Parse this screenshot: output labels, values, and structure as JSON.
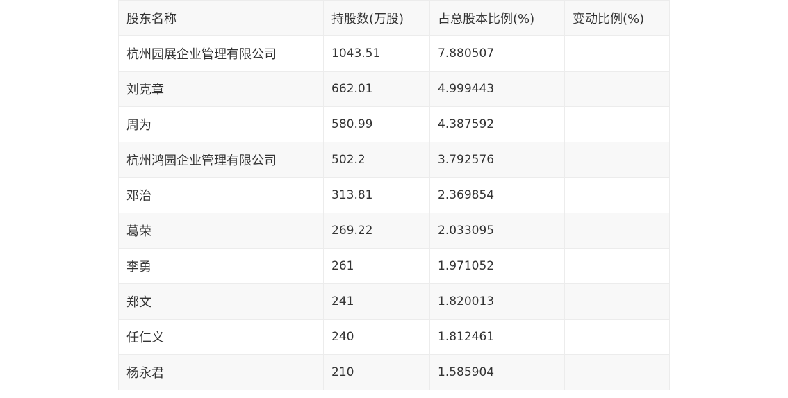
{
  "table": {
    "headers": [
      "股东名称",
      "持股数(万股)",
      "占总股本比例(%)",
      "变动比例(%)"
    ],
    "rows": [
      {
        "name": "杭州园展企业管理有限公司",
        "shares": "1043.51",
        "ratio": "7.880507",
        "change": ""
      },
      {
        "name": "刘克章",
        "shares": "662.01",
        "ratio": "4.999443",
        "change": ""
      },
      {
        "name": "周为",
        "shares": "580.99",
        "ratio": "4.387592",
        "change": ""
      },
      {
        "name": "杭州鸿园企业管理有限公司",
        "shares": "502.2",
        "ratio": "3.792576",
        "change": ""
      },
      {
        "name": "邓治",
        "shares": "313.81",
        "ratio": "2.369854",
        "change": ""
      },
      {
        "name": "葛荣",
        "shares": "269.22",
        "ratio": "2.033095",
        "change": ""
      },
      {
        "name": "李勇",
        "shares": "261",
        "ratio": "1.971052",
        "change": ""
      },
      {
        "name": "郑文",
        "shares": "241",
        "ratio": "1.820013",
        "change": ""
      },
      {
        "name": "任仁义",
        "shares": "240",
        "ratio": "1.812461",
        "change": ""
      },
      {
        "name": "杨永君",
        "shares": "210",
        "ratio": "1.585904",
        "change": ""
      }
    ]
  }
}
